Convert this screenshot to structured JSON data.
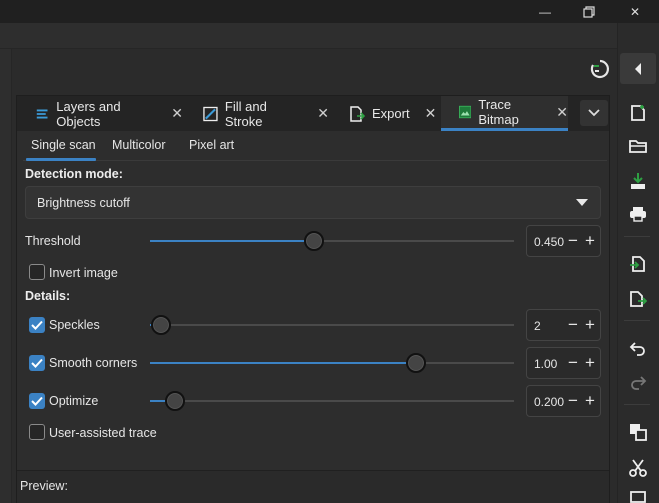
{
  "window": {
    "minimize_glyph": "—",
    "maximize_icon": "restore-icon",
    "close_glyph": "✕"
  },
  "dock": {
    "tabs": [
      {
        "label": "Layers and Objects",
        "icon": "layers-icon"
      },
      {
        "label": "Fill and Stroke",
        "icon": "fill-stroke-icon"
      },
      {
        "label": "Export",
        "icon": "export-icon"
      },
      {
        "label": "Trace Bitmap",
        "icon": "trace-bitmap-icon",
        "active": true
      }
    ],
    "close_glyph": "✕"
  },
  "trace": {
    "subtabs": [
      "Single scan",
      "Multicolor",
      "Pixel art"
    ],
    "active_subtab": "Single scan",
    "detection_label": "Detection mode:",
    "detection_value": "Brightness cutoff",
    "threshold": {
      "label": "Threshold",
      "value": "0.450",
      "level": 0.45
    },
    "invert": {
      "label": "Invert image",
      "checked": false
    },
    "details_label": "Details:",
    "speckles": {
      "label": "Speckles",
      "value": "2",
      "checked": true,
      "level": 0.0
    },
    "smooth_corners": {
      "label": "Smooth corners",
      "value": "1.00",
      "checked": true,
      "level": 0.75
    },
    "optimize": {
      "label": "Optimize",
      "value": "0.200",
      "checked": true,
      "level": 0.04
    },
    "user_assisted": {
      "label": "User-assisted trace",
      "checked": false
    },
    "preview_label": "Preview:"
  },
  "colors": {
    "accent": "#3b82c4",
    "panel": "#2d2d2d",
    "tabbar": "#242424",
    "export_green": "#2ea043"
  }
}
